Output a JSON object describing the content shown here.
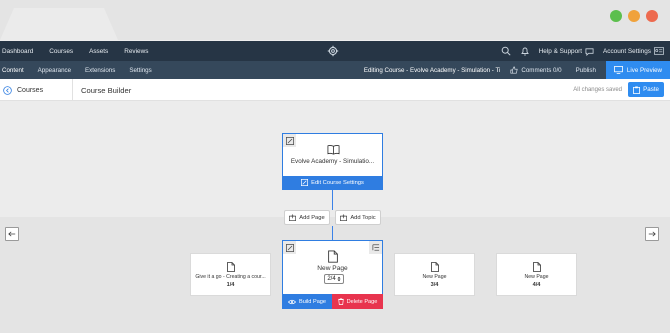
{
  "window": {
    "dots": [
      "#5cbf4d",
      "#f0a23b",
      "#ed6a4f"
    ]
  },
  "topnav": {
    "items": [
      "Dashboard",
      "Courses",
      "Assets",
      "Reviews"
    ],
    "help_label": "Help & Support",
    "account_label": "Account Settings"
  },
  "subnav": {
    "items": [
      "Content",
      "Appearance",
      "Extensions",
      "Settings"
    ],
    "editing_label": "Editing Course - Evolve Academy - Simulation - Ti",
    "comments_label": "Comments 0/0",
    "publish_label": "Publish",
    "live_preview_label": "Live Preview"
  },
  "crumbbar": {
    "courses_label": "Courses",
    "title": "Course Builder",
    "saved_status": "All changes saved",
    "paste_label": "Paste"
  },
  "course_card": {
    "title": "Evolve Academy - Simulatio...",
    "settings_label": "Edit Course Settings"
  },
  "buttons": {
    "add_page": "Add Page",
    "add_topic": "Add Topic",
    "build_page": "Build Page",
    "delete_page": "Delete Page"
  },
  "pages": [
    {
      "title": "Give it a go - Creating a cour...",
      "position": "1/4"
    },
    {
      "title": "New Page",
      "position": "2/4"
    },
    {
      "title": "New Page",
      "position": "3/4"
    },
    {
      "title": "New Page",
      "position": "4/4"
    }
  ],
  "colors": {
    "accent": "#2f7de1",
    "delete": "#e8344e",
    "nav_dark": "#263545",
    "nav_sub": "#35485b"
  }
}
